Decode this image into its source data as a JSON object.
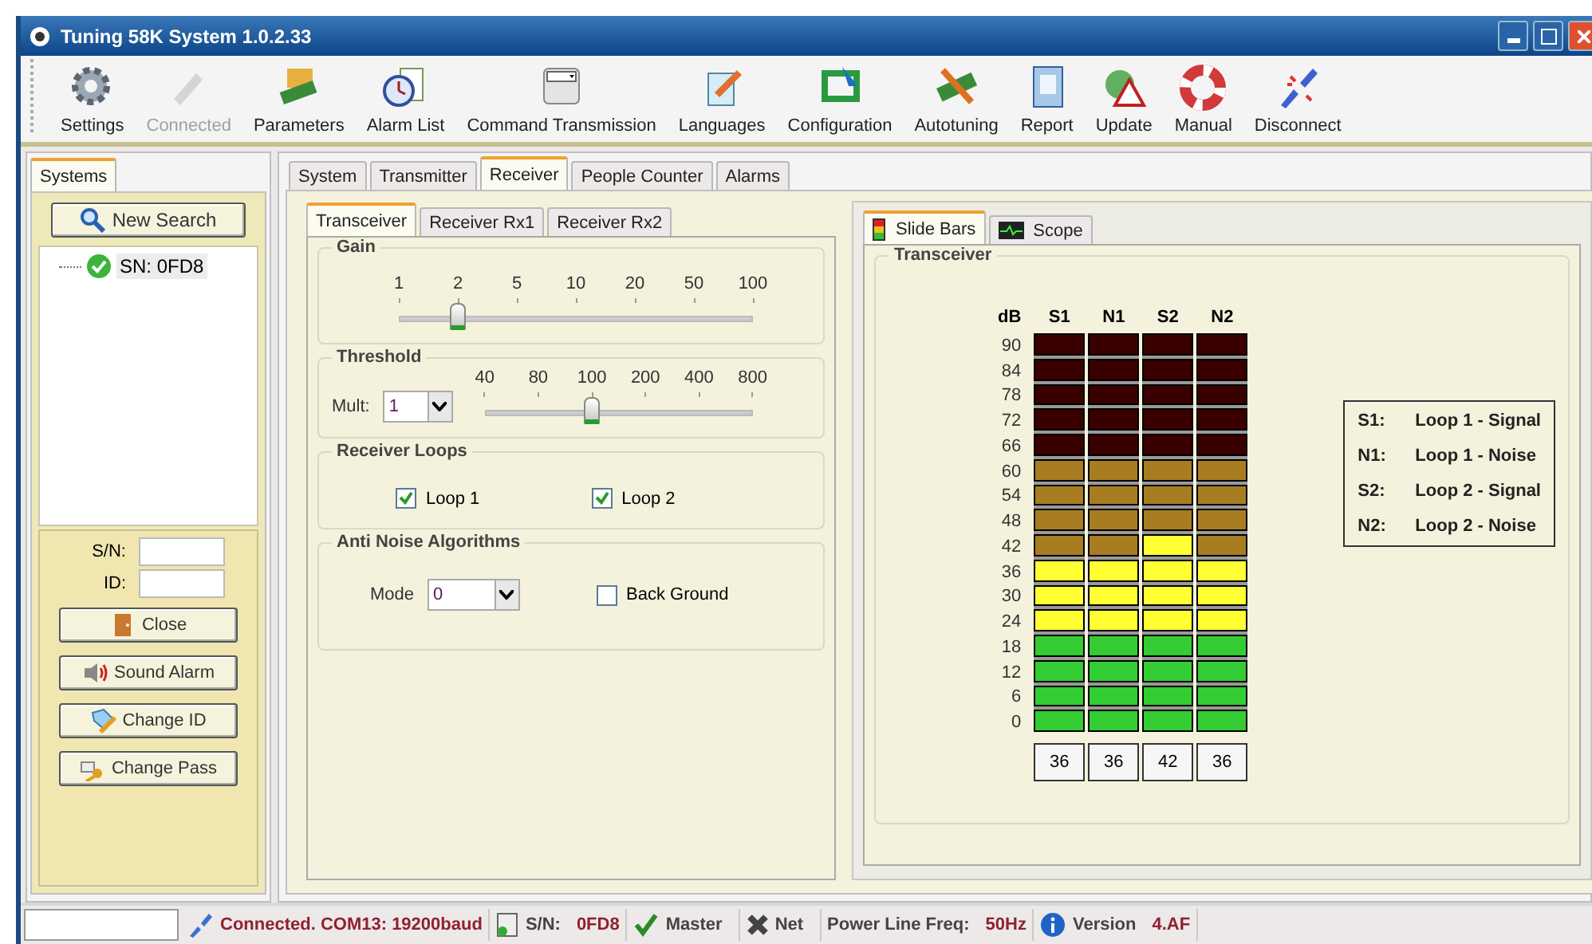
{
  "window": {
    "title": "Tuning 58K System 1.0.2.33"
  },
  "toolbar": [
    {
      "label": "Settings",
      "disabled": false
    },
    {
      "label": "Connected",
      "disabled": true
    },
    {
      "label": "Parameters",
      "disabled": false
    },
    {
      "label": "Alarm List",
      "disabled": false
    },
    {
      "label": "Command Transmission",
      "disabled": false
    },
    {
      "label": "Languages",
      "disabled": false
    },
    {
      "label": "Configuration",
      "disabled": false
    },
    {
      "label": "Autotuning",
      "disabled": false
    },
    {
      "label": "Report",
      "disabled": false
    },
    {
      "label": "Update",
      "disabled": false
    },
    {
      "label": "Manual",
      "disabled": false
    },
    {
      "label": "Disconnect",
      "disabled": false
    }
  ],
  "sidebar": {
    "tabs": [
      {
        "label": "Systems",
        "selected": true
      }
    ],
    "new_search": "New Search",
    "tree": [
      {
        "label": "SN: 0FD8",
        "selected": true
      }
    ],
    "fields": [
      {
        "label": "S/N:"
      },
      {
        "label": "ID:"
      }
    ],
    "buttons": [
      "Close",
      "Sound Alarm",
      "Change ID",
      "Change Pass"
    ]
  },
  "main_tabs": [
    {
      "label": "System",
      "selected": false
    },
    {
      "label": "Transmitter",
      "selected": false
    },
    {
      "label": "Receiver",
      "selected": true
    },
    {
      "label": "People Counter",
      "selected": false
    },
    {
      "label": "Alarms",
      "selected": false
    }
  ],
  "receiver": {
    "tabs": [
      {
        "label": "Transceiver",
        "selected": true
      },
      {
        "label": "Receiver Rx1",
        "selected": false
      },
      {
        "label": "Receiver Rx2",
        "selected": false
      }
    ],
    "gain": {
      "title": "Gain",
      "ticks": [
        "1",
        "2",
        "5",
        "10",
        "20",
        "50",
        "100"
      ],
      "level": 0.1667
    },
    "threshold": {
      "title": "Threshold",
      "mult_label": "Mult:",
      "mult_value": "1",
      "ticks": [
        "40",
        "80",
        "100",
        "200",
        "400",
        "800"
      ],
      "level": 0.4
    },
    "loops": {
      "title": "Receiver Loops",
      "items": [
        {
          "label": "Loop 1",
          "checked": true
        },
        {
          "label": "Loop 2",
          "checked": true
        }
      ]
    },
    "anti_noise": {
      "title": "Anti Noise Algorithms",
      "mode_label": "Mode",
      "mode_value": "0",
      "background": {
        "label": "Back Ground",
        "checked": false
      }
    }
  },
  "meters": {
    "tabs": [
      {
        "label": "Slide Bars",
        "selected": true
      },
      {
        "label": "Scope",
        "selected": false
      }
    ],
    "group_title": "Transceiver",
    "unit": "dB",
    "scale": [
      "90",
      "84",
      "78",
      "72",
      "66",
      "60",
      "54",
      "48",
      "42",
      "36",
      "30",
      "24",
      "18",
      "12",
      "6",
      "0"
    ],
    "channels": [
      {
        "name": "S1",
        "level": 0.4,
        "reading": "36"
      },
      {
        "name": "N1",
        "level": 0.4,
        "reading": "36"
      },
      {
        "name": "S2",
        "level": 0.4667,
        "reading": "42"
      },
      {
        "name": "N2",
        "level": 0.4,
        "reading": "36"
      }
    ],
    "legend": [
      {
        "key": "S1:",
        "text": "Loop 1 - Signal"
      },
      {
        "key": "N1:",
        "text": "Loop 1 - Noise"
      },
      {
        "key": "S2:",
        "text": "Loop 2 - Signal"
      },
      {
        "key": "N2:",
        "text": "Loop 2 - Noise"
      }
    ]
  },
  "status_bar": {
    "connection": "Connected. COM13: 19200baud",
    "sn_label": "S/N:",
    "sn_value": "0FD8",
    "master": "Master",
    "net": "Net",
    "freq_label": "Power Line Freq:",
    "freq_value": "50Hz",
    "version_label": "Version",
    "version_value": "4.AF"
  }
}
